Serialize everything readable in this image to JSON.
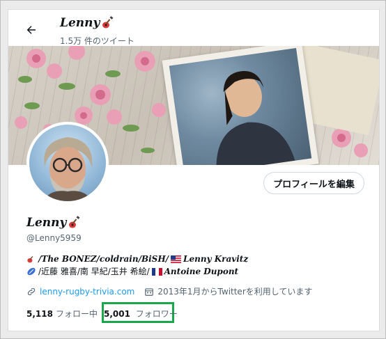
{
  "header": {
    "back_icon": "arrow-left-icon",
    "title": "Lenny",
    "title_emoji_icon": "guitar-icon",
    "tweet_count": "1.5万 件のツイート"
  },
  "profile": {
    "edit_button_label": "プロフィールを編集",
    "display_name": "Lenny",
    "name_emoji_icon": "guitar-icon",
    "handle": "@Lenny5959",
    "bio_line1": "/The BONEZ/coldrain/BiSH/",
    "bio_line1_tail": "Lenny Kravitz",
    "bio_line2": "/近藤 雅喜/南 早紀/玉井 希絵/",
    "bio_line2_tail": "Antoine Dupont",
    "link_text": "lenny-rugby-trivia.com",
    "joined_text": "2013年1月からTwitterを利用しています",
    "following_count": "5,118",
    "following_label": "フォロー中",
    "followers_count": "5,001",
    "followers_label": "フォロワー"
  },
  "colors": {
    "link": "#1d9bf0",
    "highlight_box": "#1aa64a",
    "secondary_text": "#536471"
  }
}
